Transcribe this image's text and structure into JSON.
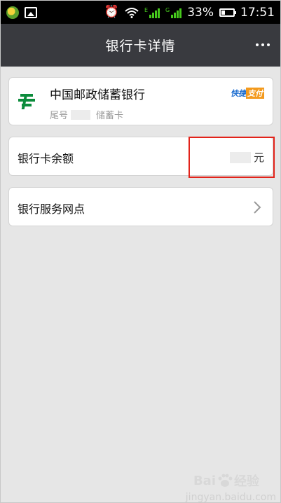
{
  "status_bar": {
    "battery_percent": "33%",
    "time": "17:51",
    "network_1": "E",
    "network_2": "G"
  },
  "header": {
    "title": "银行卡详情"
  },
  "bank_card": {
    "bank_name": "中国邮政储蓄银行",
    "tail_prefix": "尾号",
    "card_type": "储蓄卡",
    "badge_left": "快捷",
    "badge_right": "支付"
  },
  "balance": {
    "label": "银行卡余额",
    "unit": "元"
  },
  "service": {
    "label": "银行服务网点"
  },
  "watermark": {
    "brand": "Bai",
    "brand_tail": "经验",
    "site": "jingyan.baidu.com"
  },
  "colors": {
    "titlebar": "#393a3f",
    "highlight": "#e2231a",
    "bank_green": "#0c8c3c"
  }
}
